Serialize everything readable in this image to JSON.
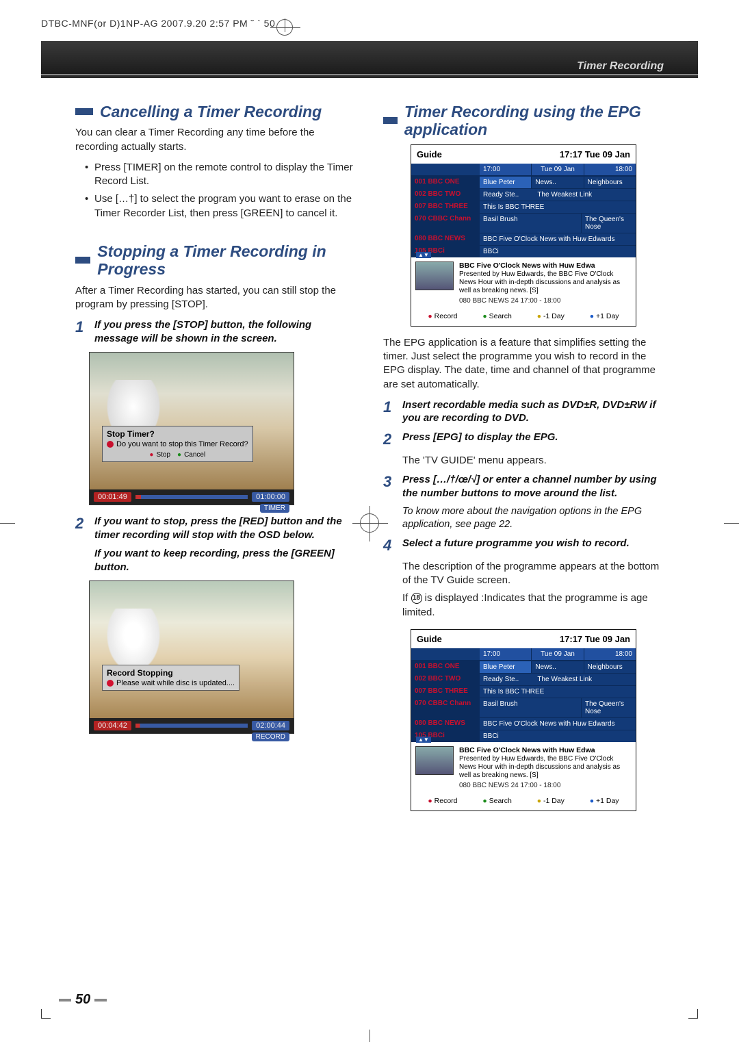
{
  "print_header": "DTBC-MNF(or D)1NP-AG  2007.9.20 2:57 PM  ˘ ` 50",
  "section_label": "Timer Recording",
  "left": {
    "h1": "Cancelling a Timer Recording",
    "p1": "You can clear a Timer Recording any time before the recording actually starts.",
    "b1": "Press [TIMER] on the remote control to display the Timer Record List.",
    "b2": "Use […†] to select the program you want to erase on the Timer Recorder List, then press [GREEN] to cancel it.",
    "h2": "Stopping a Timer Recording in Progress",
    "p2": "After a Timer Recording has started, you can still stop the program by pressing [STOP].",
    "s1": "If you press the [STOP] button, the following message will be shown in the screen.",
    "s2a": "If you want to stop, press the [RED] button and the timer recording will stop with the OSD below.",
    "s2b": "If you want to keep recording, press the [GREEN] button.",
    "shot1": {
      "title": "Stop Timer?",
      "msg": "Do you want to stop this Timer Record?",
      "btn_stop": "Stop",
      "btn_cancel": "Cancel",
      "time_l": "00:01:49",
      "time_r": "01:00:00",
      "badge": "TIMER"
    },
    "shot2": {
      "title": "Record Stopping",
      "msg": "Please wait while disc is updated....",
      "time_l": "00:04:42",
      "time_r": "02:00:44",
      "badge": "RECORD"
    }
  },
  "right": {
    "h1": "Timer Recording using the EPG application",
    "p1": "The EPG application is a feature that simplifies setting the timer. Just select the programme you wish to record in the EPG display. The date, time and channel of that programme are set automatically.",
    "s1": "Insert recordable media such as DVD±R, DVD±RW if you are recording to DVD.",
    "s2": "Press [EPG] to display the EPG.",
    "s2_note": "The 'TV GUIDE' menu appears.",
    "s3": "Press […/†/œ/√] or enter a channel number by using the number buttons to move around the list.",
    "s3_note": "To know more about the navigation options in the EPG application, see page 22.",
    "s4": "Select a future programme you wish to record.",
    "s4_note1": "The description of the programme appears at the bottom of the TV Guide screen.",
    "s4_note2a": "If ",
    "s4_note2b": " is displayed :Indicates that the programme is age limited.",
    "age_label": "18",
    "guide": {
      "title": "Guide",
      "clock": "17:17 Tue 09 Jan",
      "t1": "17:00",
      "t2": "Tue 09 Jan",
      "t3": "18:00",
      "channels": [
        "001 BBC ONE",
        "002 BBC TWO",
        "007 BBC THREE",
        "070 CBBC Chann",
        "080 BBC NEWS",
        "105 BBCi"
      ],
      "rows": [
        [
          "Blue Peter",
          "News..",
          "Neighbours"
        ],
        [
          "Ready Ste..",
          "The Weakest Link"
        ],
        [
          "This Is BBC THREE"
        ],
        [
          "Basil Brush",
          "The Queen's Nose"
        ],
        [
          "BBC Five O'Clock News with Huw Edwards"
        ],
        [
          "BBCi"
        ]
      ],
      "desc_title": "BBC Five O'Clock News with Huw Edwa",
      "desc_body": "Presented by Huw Edwards, the BBC Five O'Clock News Hour with in-depth discussions and analysis as well as breaking news. [S]",
      "desc_ch": "080 BBC NEWS 24 17:00 - 18:00",
      "btn_record": "Record",
      "btn_search": "Search",
      "btn_minus": "-1 Day",
      "btn_plus": "+1 Day"
    }
  },
  "page_number": "50"
}
